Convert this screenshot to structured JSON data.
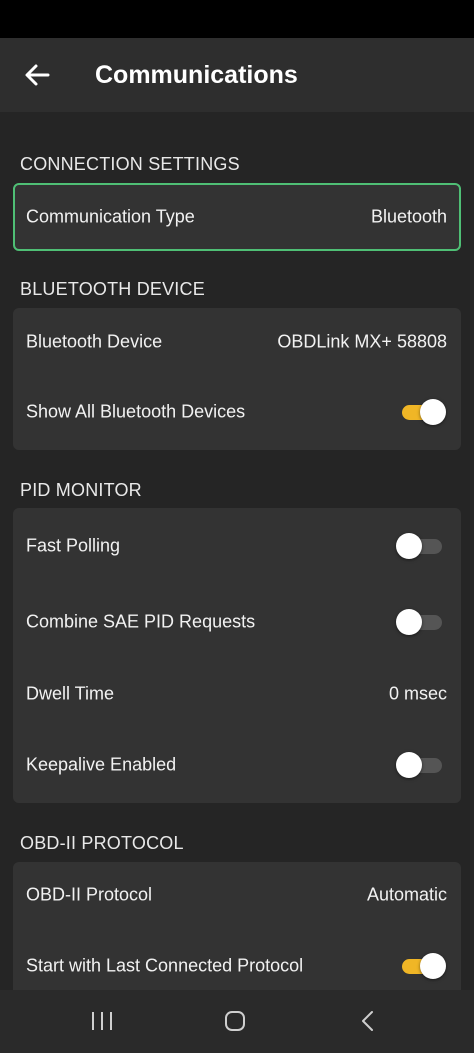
{
  "header": {
    "title": "Communications",
    "back_icon": "arrow-left-icon"
  },
  "sections": {
    "connection": {
      "title": "CONNECTION SETTINGS",
      "communication_type": {
        "label": "Communication Type",
        "value": "Bluetooth"
      }
    },
    "bluetooth": {
      "title": "BLUETOOTH DEVICE",
      "device": {
        "label": "Bluetooth Device",
        "value": "OBDLink MX+ 58808"
      },
      "show_all": {
        "label": "Show All Bluetooth Devices",
        "checked": true
      }
    },
    "pid_monitor": {
      "title": "PID MONITOR",
      "fast_polling": {
        "label": "Fast Polling",
        "checked": false
      },
      "combine_sae": {
        "label": "Combine SAE PID Requests",
        "checked": false
      },
      "dwell_time": {
        "label": "Dwell Time",
        "value": "0 msec"
      },
      "keepalive": {
        "label": "Keepalive Enabled",
        "checked": false
      }
    },
    "obd2": {
      "title": "OBD-II PROTOCOL",
      "protocol": {
        "label": "OBD-II Protocol",
        "value": "Automatic"
      },
      "start_last": {
        "label": "Start with Last Connected Protocol",
        "checked": true
      }
    }
  },
  "colors": {
    "accent_toggle": "#f0b626",
    "focus_border": "#4fbf75",
    "card_bg": "#333333",
    "page_bg": "#252525"
  },
  "nav": {
    "recents_icon": "recent-apps-icon",
    "home_icon": "home-icon",
    "back_icon": "nav-back-icon"
  }
}
